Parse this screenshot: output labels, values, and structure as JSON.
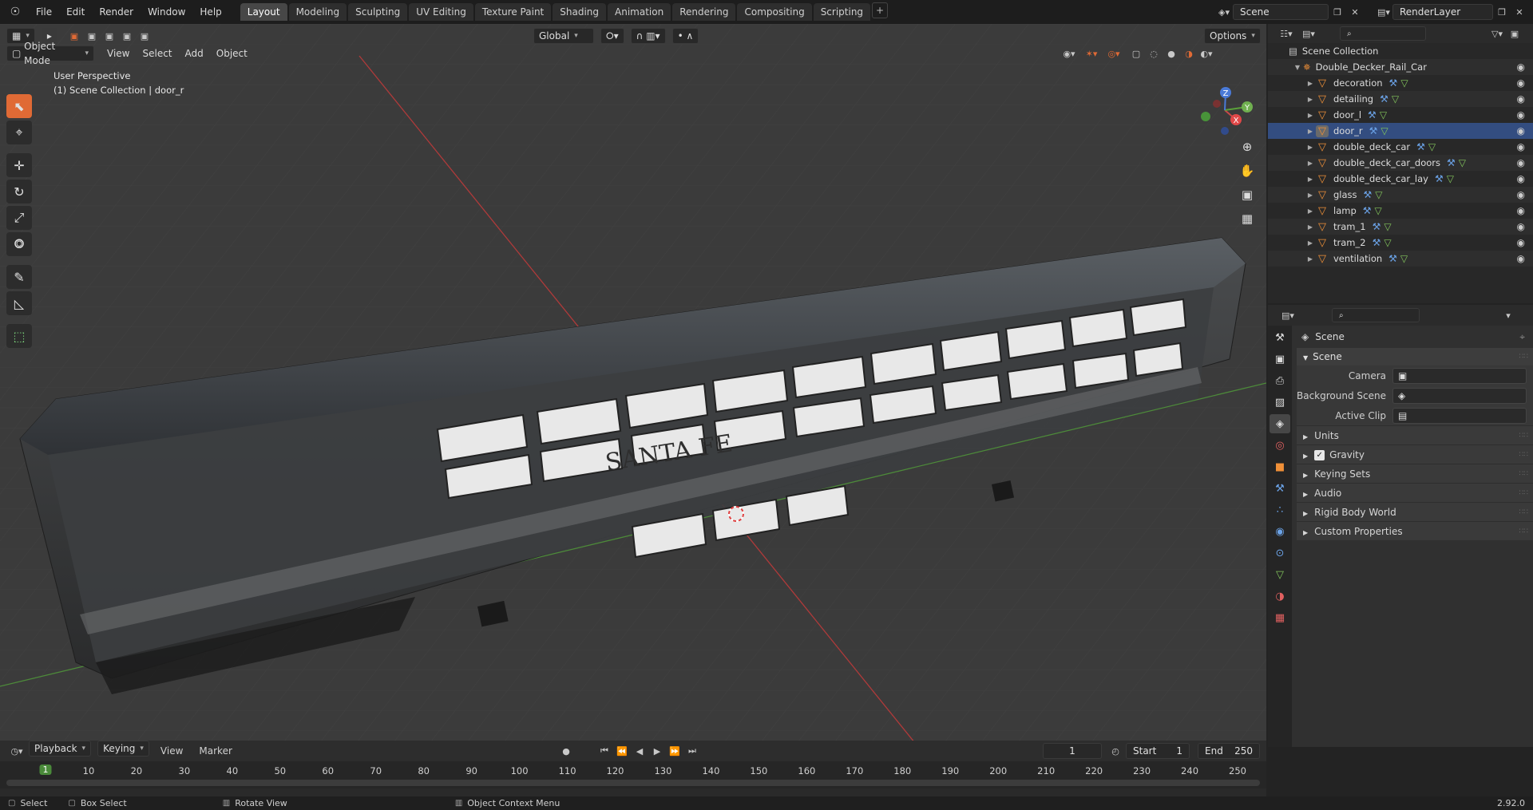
{
  "topbar": {
    "menus": [
      "File",
      "Edit",
      "Render",
      "Window",
      "Help"
    ],
    "workspaces": [
      "Layout",
      "Modeling",
      "Sculpting",
      "UV Editing",
      "Texture Paint",
      "Shading",
      "Animation",
      "Rendering",
      "Compositing",
      "Scripting"
    ],
    "active_workspace": "Layout",
    "scene": "Scene",
    "view_layer": "RenderLayer"
  },
  "viewport": {
    "mode": "Object Mode",
    "menus": [
      "View",
      "Select",
      "Add",
      "Object"
    ],
    "orientation": "Global",
    "options_label": "Options",
    "perspective_label": "User Perspective",
    "collection_label": "(1) Scene Collection | door_r",
    "gizmo_axes": [
      "X",
      "Y",
      "Z"
    ],
    "hull_lettering": "SANTA FE"
  },
  "outliner": {
    "root": "Scene Collection",
    "collection": "Double_Decker_Rail_Car",
    "objects": [
      "decoration",
      "detailing",
      "door_l",
      "door_r",
      "double_deck_car",
      "double_deck_car_doors",
      "double_deck_car_lay",
      "glass",
      "lamp",
      "tram_1",
      "tram_2",
      "ventilation"
    ],
    "selected": "door_r"
  },
  "properties": {
    "title": "Scene",
    "panel": "Scene",
    "fields": [
      {
        "label": "Camera",
        "value": ""
      },
      {
        "label": "Background Scene",
        "value": ""
      },
      {
        "label": "Active Clip",
        "value": ""
      }
    ],
    "subpanels": [
      "Units",
      "Gravity",
      "Keying Sets",
      "Audio",
      "Rigid Body World",
      "Custom Properties"
    ],
    "gravity_checked": true
  },
  "timeline": {
    "menus": [
      "Playback",
      "Keying",
      "View",
      "Marker"
    ],
    "current_frame": "1",
    "start_label": "Start",
    "start": "1",
    "end_label": "End",
    "end": "250",
    "ticks": [
      "10",
      "20",
      "30",
      "40",
      "50",
      "60",
      "70",
      "80",
      "90",
      "100",
      "110",
      "120",
      "130",
      "140",
      "150",
      "160",
      "170",
      "180",
      "190",
      "200",
      "210",
      "220",
      "230",
      "240",
      "250"
    ]
  },
  "statusbar": {
    "items": [
      "Select",
      "Box Select",
      "Rotate View",
      "Object Context Menu"
    ],
    "version": "2.92.0"
  },
  "colors": {
    "accent": "#e06a35",
    "mesh": "#f09038",
    "modifier": "#6ba2e6",
    "data": "#82c45c"
  }
}
